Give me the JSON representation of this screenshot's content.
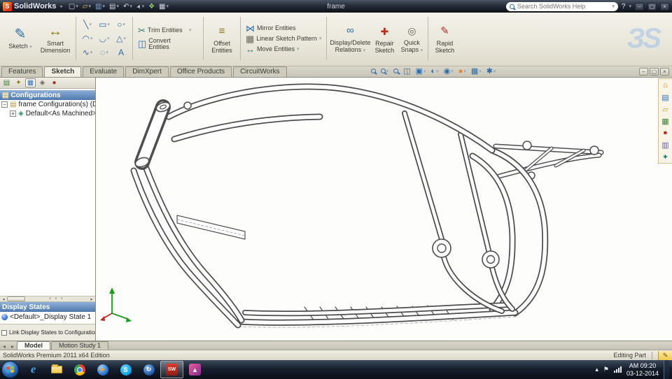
{
  "titlebar": {
    "app_name": "SolidWorks",
    "document_title": "frame",
    "search_placeholder": "Search SolidWorks Help",
    "help": "?"
  },
  "icons": {
    "logo": "S",
    "new": "▢",
    "open": "▱",
    "save": "▥",
    "print": "▤",
    "undo": "↶",
    "select": "➤",
    "rebuild": "❖",
    "grid": "▦",
    "sketch_big": "✎",
    "smartdim": "↔",
    "trim": "✂",
    "convert": "◫",
    "offset": "≡",
    "mirror": "⋈",
    "pattern": "▦",
    "move": "↔",
    "relations": "∞",
    "repair": "✚",
    "snaps": "◎",
    "rapid": "✎",
    "hud_cube": "▣",
    "hud_section": "◫",
    "hud_display": "◐",
    "hud_eye": "◉",
    "hud_scene": "▦",
    "hud_gear": "✱",
    "win_min": "–",
    "win_restore": "▢",
    "win_close": "×",
    "tree_tab": "▤",
    "prop_tab": "✦",
    "config_tab": "▦",
    "dim_tab": "◈",
    "disp_tab": "●",
    "config_folder": "▤",
    "config_item": "◈",
    "tp_home": "⌂",
    "tp_lib": "▤",
    "tp_folder": "▱",
    "tp_palette": "▦",
    "tp_props": "▥",
    "tp_scene": "●",
    "tp_star": "✦",
    "bnav_l": "◂",
    "bnav_r": "▸",
    "edit_pencil": "✎",
    "tray_chevron": "▴",
    "tray_flag": "⚑"
  },
  "grid_tools": [
    "╲",
    "▭",
    "○",
    "◠",
    "◡",
    "△",
    "∿",
    "◌",
    "A"
  ],
  "ribbon": {
    "sketch": "Sketch",
    "smart_dimension": "Smart Dimension",
    "trim": "Trim Entities",
    "convert": "Convert Entities",
    "offset": "Offset Entities",
    "mirror": "Mirror Entities",
    "pattern": "Linear Sketch Pattern",
    "move": "Move Entities",
    "relations": "Display/Delete Relations",
    "repair": "Repair Sketch",
    "snaps": "Quick Snaps",
    "rapid": "Rapid Sketch",
    "watermark": "ЗS"
  },
  "tabs": {
    "items": [
      {
        "label": "Features"
      },
      {
        "label": "Sketch"
      },
      {
        "label": "Evaluate"
      },
      {
        "label": "DimXpert"
      },
      {
        "label": "Office Products"
      },
      {
        "label": "CircuitWorks"
      }
    ]
  },
  "panel": {
    "configurations": "Configurations",
    "root": "frame Configuration(s)  (Defa",
    "child": "Default<As Machined>  [",
    "display_states": "Display States",
    "state_item": "<Default>_Display State 1",
    "link_label": "Link Display States to Configurations"
  },
  "bottom": {
    "model": "Model",
    "motion": "Motion Study 1"
  },
  "status": {
    "left": "SolidWorks Premium 2011 x64 Edition",
    "editing": "Editing Part"
  },
  "clock": {
    "time": "AM 09:20",
    "date": "03-12-2014"
  },
  "tb": {
    "ie": "e",
    "skype": "S",
    "sw": "SW"
  }
}
